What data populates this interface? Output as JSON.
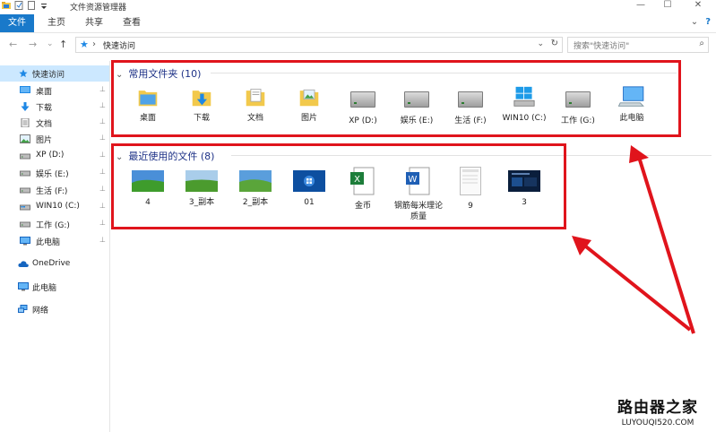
{
  "window": {
    "title": "文件资源管理器",
    "controls": {
      "minimize": "—",
      "maximize": "☐",
      "close": "✕"
    }
  },
  "ribbon": {
    "tabs": [
      "文件",
      "主页",
      "共享",
      "查看"
    ],
    "right_icons": {
      "collapse": "⌄",
      "help": "?"
    }
  },
  "navigation": {
    "back": "←",
    "forward": "→",
    "recent": "⌄",
    "up": "↑"
  },
  "address": {
    "separator": "›",
    "path": "快速访问",
    "dropdown": "⌄",
    "refresh": "↻"
  },
  "search": {
    "placeholder": "搜索\"快速访问\"",
    "icon": "⌕"
  },
  "sidebar": {
    "items": [
      {
        "label": "快速访问",
        "icon": "star-icon",
        "pinned": false
      },
      {
        "label": "桌面",
        "icon": "desktop-icon",
        "pinned": true
      },
      {
        "label": "下载",
        "icon": "download-icon",
        "pinned": true
      },
      {
        "label": "文档",
        "icon": "document-icon",
        "pinned": true
      },
      {
        "label": "图片",
        "icon": "picture-icon",
        "pinned": true
      },
      {
        "label": "XP (D:)",
        "icon": "drive-icon",
        "pinned": true
      },
      {
        "label": "娱乐 (E:)",
        "icon": "drive-icon",
        "pinned": true
      },
      {
        "label": "生活 (F:)",
        "icon": "drive-icon",
        "pinned": true
      },
      {
        "label": "WIN10 (C:)",
        "icon": "windows-drive-icon",
        "pinned": true
      },
      {
        "label": "工作 (G:)",
        "icon": "drive-icon",
        "pinned": true
      },
      {
        "label": "此电脑",
        "icon": "computer-icon",
        "pinned": true
      },
      {
        "label": "OneDrive",
        "icon": "cloud-icon",
        "pinned": false
      },
      {
        "label": "此电脑",
        "icon": "computer-icon",
        "pinned": false
      },
      {
        "label": "网络",
        "icon": "network-icon",
        "pinned": false
      }
    ],
    "pin_glyph": "📌"
  },
  "frequent": {
    "header": "常用文件夹 (10)",
    "chevron": "⌄",
    "items": [
      {
        "label": "桌面",
        "icon": "desktop-folder-icon"
      },
      {
        "label": "下载",
        "icon": "download-folder-icon"
      },
      {
        "label": "文档",
        "icon": "documents-folder-icon"
      },
      {
        "label": "图片",
        "icon": "pictures-folder-icon"
      },
      {
        "label": "XP (D:)",
        "icon": "drive-icon"
      },
      {
        "label": "娱乐 (E:)",
        "icon": "drive-icon"
      },
      {
        "label": "生活 (F:)",
        "icon": "drive-icon"
      },
      {
        "label": "WIN10 (C:)",
        "icon": "windows-drive-icon"
      },
      {
        "label": "工作 (G:)",
        "icon": "drive-icon"
      },
      {
        "label": "此电脑",
        "icon": "computer-icon"
      }
    ]
  },
  "recent": {
    "header": "最近使用的文件 (8)",
    "chevron": "⌄",
    "items": [
      {
        "label": "4",
        "icon": "landscape-image-icon"
      },
      {
        "label": "3_副本",
        "icon": "landscape-image-icon"
      },
      {
        "label": "2_副本",
        "icon": "landscape-image-icon"
      },
      {
        "label": "01",
        "icon": "windows7-wallpaper-icon"
      },
      {
        "label": "金币",
        "icon": "excel-file-icon"
      },
      {
        "label": "钢筋每米理论质量",
        "icon": "word-file-icon"
      },
      {
        "label": "9",
        "icon": "document-thumbnail-icon"
      },
      {
        "label": "3",
        "icon": "dark-screenshot-icon"
      }
    ]
  },
  "watermark": {
    "line1": "路由器之家",
    "line2": "LUYOUQI520.COM"
  },
  "colors": {
    "file_tab": "#1979ca",
    "group_header": "#1e3287",
    "selection": "#cce8ff",
    "annotation_red": "#e0141c",
    "folder_yellow": "#f2c94c"
  }
}
